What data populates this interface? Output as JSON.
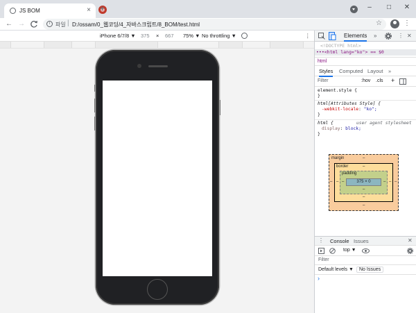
{
  "browser": {
    "tab_title": "JS BOM",
    "tab_close": "×",
    "new_tab": "+",
    "window_controls": [
      "–",
      "□",
      "✕"
    ],
    "nav": {
      "back": "←",
      "forward": "→",
      "reload": "C"
    },
    "address": {
      "scheme_label": "파일",
      "separator": "|",
      "url": "D:/ossam/0_웹코딩/4_자바스크립트/8_BOM/test.html",
      "star": "☆"
    },
    "menu": "⋮"
  },
  "device_toolbar": {
    "device": "iPhone 6/7/8 ▼",
    "width": "375",
    "times": "×",
    "height": "667",
    "zoom": "75% ▼",
    "throttling": "No throttling ▼",
    "more": "⋮"
  },
  "devtools": {
    "tab_elements": "Elements",
    "more_tabs": "»",
    "close": "✕",
    "dom_lines": [
      "<!DOCTYPE html>",
      "•••<html lang=\"ko\"> == $0"
    ],
    "breadcrumb": "html",
    "subtabs": [
      "Styles",
      "Computed",
      "Layout",
      "»"
    ],
    "filter_placeholder": "Filter",
    "filter_hov": ":hov",
    "filter_cls": ".cls",
    "filter_plus": "+",
    "rules": {
      "r1_selector": "element.style {",
      "r1_close": "}",
      "r2_selector": "html[Attributes Style] {",
      "r2_prop": "-webkit-locale",
      "r2_val": "\"ko\";",
      "r2_close": "}",
      "r3_selector": "html {",
      "r3_source": "user agent stylesheet",
      "r3_prop": "display",
      "r3_val": "block;",
      "r3_close": "}"
    },
    "box_model": {
      "margin": "margin",
      "border": "border",
      "padding": "padding",
      "content": "375 × 0",
      "dash": "–"
    },
    "console": {
      "tab_console": "Console",
      "tab_issues": "Issues",
      "close": "✕",
      "context": "top ▼",
      "filter_placeholder": "Filter",
      "levels": "Default levels ▼",
      "no_issues": "No Issues",
      "prompt": "›"
    }
  }
}
